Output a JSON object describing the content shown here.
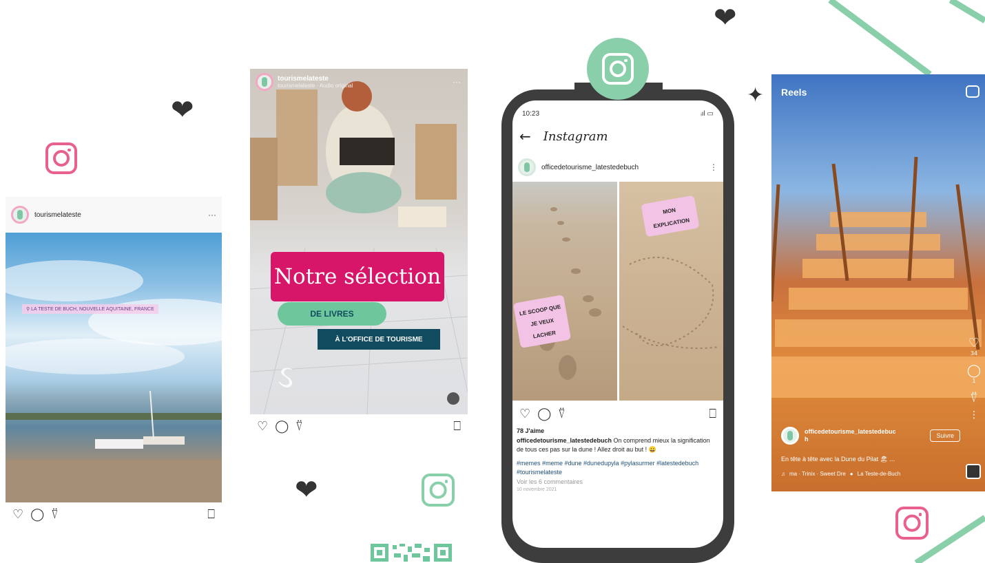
{
  "colors": {
    "ig_pink": "#e8608f",
    "ig_green": "#89cfa9",
    "phone_frame": "#3d3d3d",
    "dark_heart": "#333333",
    "magenta": "#d7166a",
    "teal_banner": "#114b5f",
    "green_pill": "#6ec79c"
  },
  "hearts": [
    "heart-icon",
    "heart-icon",
    "heart-icon"
  ],
  "post1": {
    "username": "tourismelateste",
    "location": "LA TESTE DE BUCH, NOUVELLE AQUITAINE, FRANCE",
    "menu": "···"
  },
  "story": {
    "username": "tourismelateste",
    "subtitle": "tourismelateste · Audio original",
    "menu": "···",
    "title": "Notre sélection",
    "pill": "DE LIVRES",
    "banner": "À L'OFFICE DE TOURISME"
  },
  "phone": {
    "status_time": "10:23",
    "status_right": "ᵢıl ▭",
    "app_title": "Instagram",
    "username": "officedetourisme_latestedebuch",
    "sticker_left": "LE SCOOP QUE JE VEUX LACHER",
    "sticker_right": "MON EXPLICATION",
    "likes": "78 J'aime",
    "caption_user": "officedetourisme_latestedebuch",
    "caption_text": " On comprend mieux la signification de tous ces pas sur la dune ! Allez droit au but ! 😀",
    "hashtags": "#memes #meme #dune #dunedupyla #pylasurmer #latestedebuch #tourismelateste",
    "comments": "Voir les 6 commentaires",
    "date": "10 novembre 2021"
  },
  "reel": {
    "title": "Reels",
    "like_count": "34",
    "comment_count": "1",
    "username": "officedetourisme_latestedebuc",
    "username_line2": "h",
    "follow": "Suivre",
    "caption": "En tête à tête avec la Dune du Pilat 🏖 ...",
    "audio": "ma · Trinix · Sweet Dre",
    "location": "La Teste-de-Buch"
  }
}
